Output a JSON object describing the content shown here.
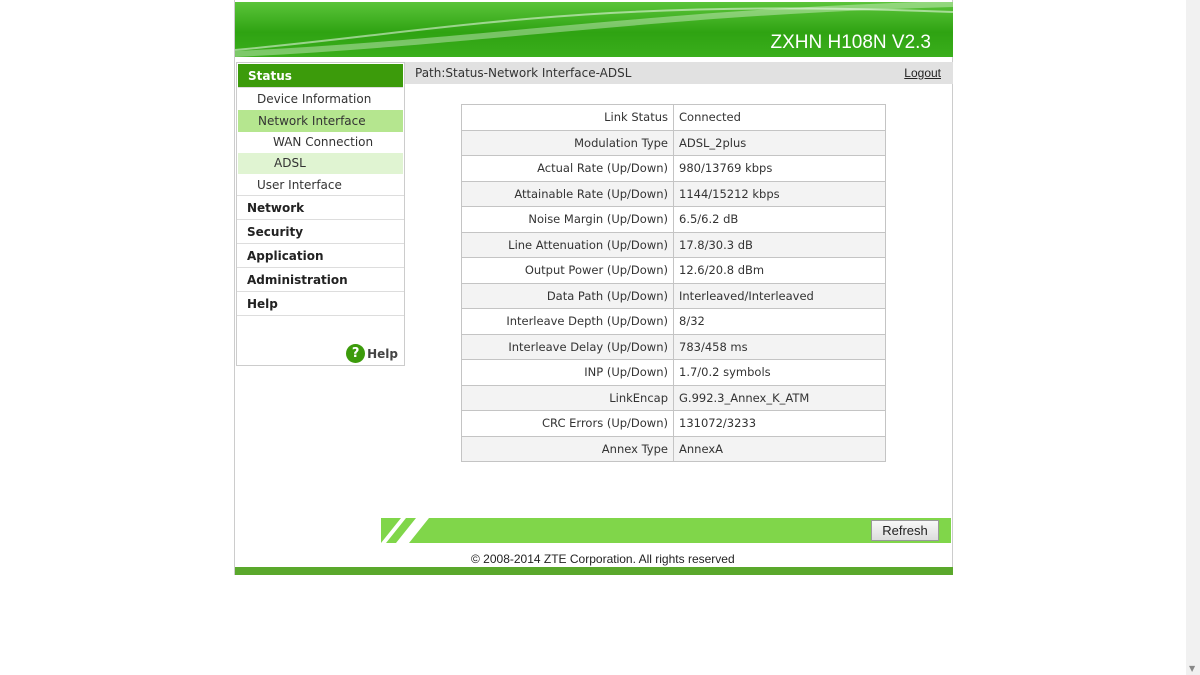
{
  "header": {
    "product": "ZXHN H108N V2.3"
  },
  "sidebar": {
    "status": "Status",
    "device_info": "Device Information",
    "network_interface": "Network Interface",
    "wan_connection": "WAN Connection",
    "adsl": "ADSL",
    "user_interface": "User Interface",
    "network": "Network",
    "security": "Security",
    "application": "Application",
    "administration": "Administration",
    "help": "Help",
    "help_link": "Help"
  },
  "path": "Path:Status-Network Interface-ADSL",
  "logout": "Logout",
  "rows": [
    [
      "Link Status",
      "Connected"
    ],
    [
      "Modulation Type",
      "ADSL_2plus"
    ],
    [
      "Actual Rate (Up/Down)",
      "980/13769 kbps"
    ],
    [
      "Attainable Rate (Up/Down)",
      "1144/15212 kbps"
    ],
    [
      "Noise Margin (Up/Down)",
      "6.5/6.2 dB"
    ],
    [
      "Line Attenuation (Up/Down)",
      "17.8/30.3 dB"
    ],
    [
      "Output Power (Up/Down)",
      "12.6/20.8 dBm"
    ],
    [
      "Data Path (Up/Down)",
      "Interleaved/Interleaved"
    ],
    [
      "Interleave Depth (Up/Down)",
      "8/32"
    ],
    [
      "Interleave Delay (Up/Down)",
      "783/458 ms"
    ],
    [
      "INP (Up/Down)",
      "1.7/0.2 symbols"
    ],
    [
      "LinkEncap",
      "G.992.3_Annex_K_ATM"
    ],
    [
      "CRC Errors (Up/Down)",
      "131072/3233"
    ],
    [
      "Annex Type",
      "AnnexA"
    ]
  ],
  "refresh": "Refresh",
  "copyright": "© 2008-2014 ZTE Corporation. All rights reserved"
}
